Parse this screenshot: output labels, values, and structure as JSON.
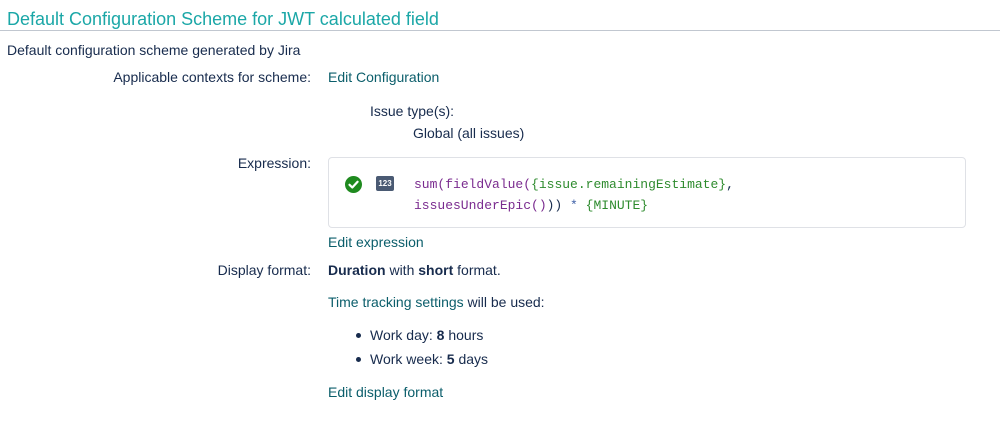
{
  "header": {
    "title": "Default Configuration Scheme for JWT calculated field",
    "subtitle": "Default configuration scheme generated by Jira"
  },
  "contexts": {
    "label": "Applicable contexts for scheme:",
    "edit_link": "Edit Configuration",
    "issue_types_label": "Issue type(s):",
    "issue_types_value": "Global (all issues)"
  },
  "expression": {
    "label": "Expression:",
    "status_icon": "check-circle-icon",
    "type_badge": "123",
    "line1": {
      "fn1": "sum(",
      "fn2": "fieldValue(",
      "field": "{issue.remainingEstimate}",
      "comma": ","
    },
    "line2": {
      "fn3": "issuesUnderEpic()",
      "close": "))",
      "op": "*",
      "field": "{MINUTE}"
    },
    "edit_link": "Edit expression"
  },
  "display_format": {
    "label": "Display format:",
    "type_bold": "Duration",
    "with_text": " with ",
    "format_bold": "short",
    "format_text": " format.",
    "settings_link": "Time tracking settings",
    "settings_text": " will be used:",
    "work_day_label": "Work day: ",
    "work_day_value": "8",
    "work_day_unit": " hours",
    "work_week_label": "Work week: ",
    "work_week_value": "5",
    "work_week_unit": " days",
    "edit_link": "Edit display format"
  },
  "colors": {
    "title": "#1ba7a7",
    "link": "#0b5e6b",
    "check": "#1f8a1f",
    "code_function": "#7a2b8f",
    "code_field": "#2e8b2e",
    "code_operator": "#3d5fa6"
  }
}
